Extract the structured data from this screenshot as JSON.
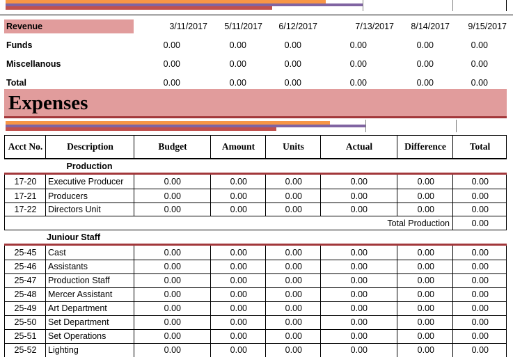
{
  "colors": {
    "pink": "#e19c9c",
    "dark_red": "#a2373a",
    "orange": "#f79646",
    "purple": "#8064a2"
  },
  "revenue": {
    "label": "Revenue",
    "dates": [
      "3/11/2017",
      "5/11/2017",
      "6/12/2017",
      "7/13/2017",
      "8/14/2017",
      "9/15/2017"
    ],
    "rows": [
      {
        "label": "Funds",
        "values": [
          "0.00",
          "0.00",
          "0.00",
          "0.00",
          "0.00",
          "0.00"
        ]
      },
      {
        "label": "Miscellanous",
        "values": [
          "0.00",
          "0.00",
          "0.00",
          "0.00",
          "0.00",
          "0.00"
        ]
      },
      {
        "label": "Total",
        "values": [
          "0.00",
          "0.00",
          "0.00",
          "0.00",
          "0.00",
          "0.00"
        ]
      }
    ]
  },
  "expenses": {
    "title": "Expenses",
    "headers": [
      "Acct No.",
      "Description",
      "Budget",
      "Amount",
      "Units",
      "Actual",
      "Difference",
      "Total"
    ],
    "production": {
      "heading": "Production",
      "rows": [
        {
          "acct": "17-20",
          "desc": "Executive Producer",
          "values": [
            "0.00",
            "0.00",
            "0.00",
            "0.00",
            "0.00",
            "0.00"
          ]
        },
        {
          "acct": "17-21",
          "desc": "Producers",
          "values": [
            "0.00",
            "0.00",
            "0.00",
            "0.00",
            "0.00",
            "0.00"
          ]
        },
        {
          "acct": "17-22",
          "desc": "Directors Unit",
          "values": [
            "0.00",
            "0.00",
            "0.00",
            "0.00",
            "0.00",
            "0.00"
          ]
        }
      ],
      "total_label": "Total Production",
      "total_value": "0.00"
    },
    "junior": {
      "heading": "Juniour Staff",
      "rows": [
        {
          "acct": "25-45",
          "desc": "Cast",
          "values": [
            "0.00",
            "0.00",
            "0.00",
            "0.00",
            "0.00",
            "0.00"
          ]
        },
        {
          "acct": "25-46",
          "desc": "Assistants",
          "values": [
            "0.00",
            "0.00",
            "0.00",
            "0.00",
            "0.00",
            "0.00"
          ]
        },
        {
          "acct": "25-47",
          "desc": "Production Staff",
          "values": [
            "0.00",
            "0.00",
            "0.00",
            "0.00",
            "0.00",
            "0.00"
          ]
        },
        {
          "acct": "25-48",
          "desc": "Mercer Assistant",
          "values": [
            "0.00",
            "0.00",
            "0.00",
            "0.00",
            "0.00",
            "0.00"
          ]
        },
        {
          "acct": "25-49",
          "desc": "Art Department",
          "values": [
            "0.00",
            "0.00",
            "0.00",
            "0.00",
            "0.00",
            "0.00"
          ]
        },
        {
          "acct": "25-50",
          "desc": "Set Department",
          "values": [
            "0.00",
            "0.00",
            "0.00",
            "0.00",
            "0.00",
            "0.00"
          ]
        },
        {
          "acct": "25-51",
          "desc": "Set Operations",
          "values": [
            "0.00",
            "0.00",
            "0.00",
            "0.00",
            "0.00",
            "0.00"
          ]
        },
        {
          "acct": "25-52",
          "desc": "Lighting",
          "values": [
            "0.00",
            "0.00",
            "0.00",
            "0.00",
            "0.00",
            "0.00"
          ]
        }
      ]
    }
  }
}
